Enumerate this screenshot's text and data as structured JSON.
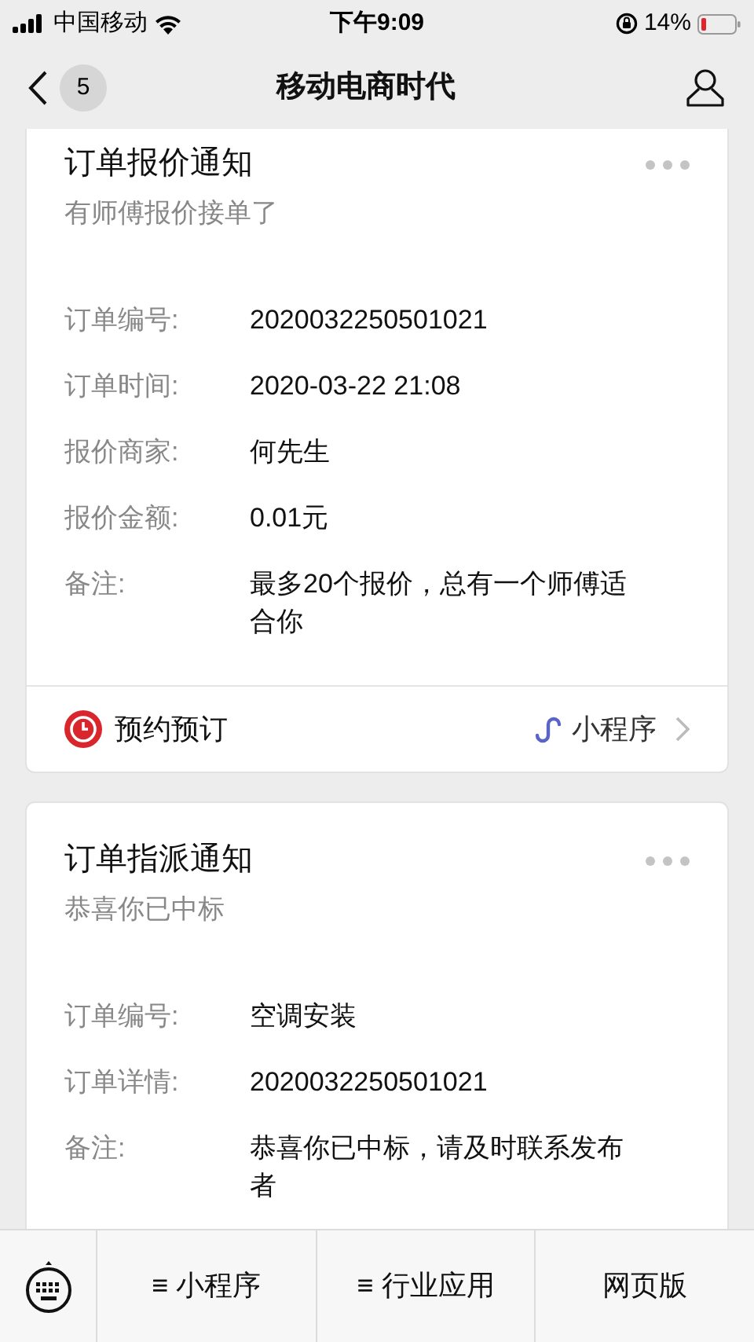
{
  "status_bar": {
    "carrier": "中国移动",
    "time": "下午9:09",
    "battery": "14%"
  },
  "nav": {
    "back_count": "5",
    "title": "移动电商时代"
  },
  "cards": [
    {
      "title": "订单报价通知",
      "subtitle": "有师傅报价接单了",
      "fields": [
        {
          "label": "订单编号:",
          "value": "2020032250501021"
        },
        {
          "label": "订单时间:",
          "value": "2020-03-22 21:08"
        },
        {
          "label": "报价商家:",
          "value": "何先生"
        },
        {
          "label": "报价金额:",
          "value": "0.01元"
        },
        {
          "label": "备注:",
          "value": "最多20个报价，总有一个师傅适合你"
        }
      ],
      "footer": {
        "name": "预约预订",
        "link": "小程序"
      }
    },
    {
      "title": "订单指派通知",
      "subtitle": "恭喜你已中标",
      "fields": [
        {
          "label": "订单编号:",
          "value": "空调安装"
        },
        {
          "label": "订单详情:",
          "value": "2020032250501021"
        },
        {
          "label": "备注:",
          "value": "恭喜你已中标，请及时联系发布者"
        }
      ]
    }
  ],
  "menu": [
    {
      "label": "≡ 小程序"
    },
    {
      "label": "≡ 行业应用"
    },
    {
      "label": "网页版"
    }
  ]
}
